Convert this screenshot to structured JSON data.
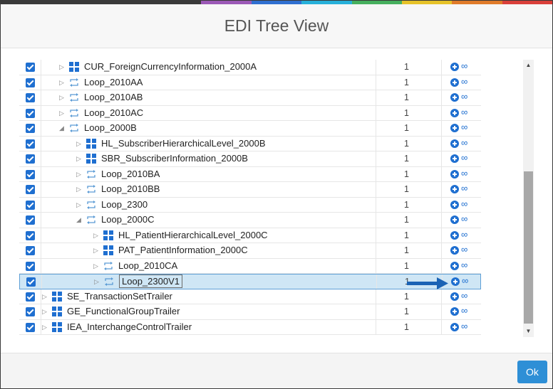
{
  "rainbow": [
    "#3a3a3a",
    "#3a3a3a",
    "#3a3a3a",
    "#3a3a3a",
    "#9b59b6",
    "#2f6fd0",
    "#27b0d9",
    "#46b05e",
    "#e6c229",
    "#e07b2a",
    "#d9403a"
  ],
  "dialog": {
    "title": "EDI Tree View",
    "ok_label": "Ok"
  },
  "colors": {
    "accent": "#1f6fd0",
    "selected_row": "#cfe6f5",
    "arrow": "#1b63b5"
  },
  "rows": [
    {
      "label": "CUR_ForeignCurrencyInformation_2000A",
      "count": "1",
      "depth": 2,
      "icon": "segment-icon",
      "expanded": false
    },
    {
      "label": "Loop_2010AA",
      "count": "1",
      "depth": 2,
      "icon": "loop-icon",
      "expanded": false
    },
    {
      "label": "Loop_2010AB",
      "count": "1",
      "depth": 2,
      "icon": "loop-icon",
      "expanded": false
    },
    {
      "label": "Loop_2010AC",
      "count": "1",
      "depth": 2,
      "icon": "loop-icon",
      "expanded": false
    },
    {
      "label": "Loop_2000B",
      "count": "1",
      "depth": 2,
      "icon": "loop-icon",
      "expanded": true
    },
    {
      "label": "HL_SubscriberHierarchicalLevel_2000B",
      "count": "1",
      "depth": 3,
      "icon": "segment-icon",
      "expanded": false
    },
    {
      "label": "SBR_SubscriberInformation_2000B",
      "count": "1",
      "depth": 3,
      "icon": "segment-icon",
      "expanded": false
    },
    {
      "label": "Loop_2010BA",
      "count": "1",
      "depth": 3,
      "icon": "loop-icon",
      "expanded": false
    },
    {
      "label": "Loop_2010BB",
      "count": "1",
      "depth": 3,
      "icon": "loop-icon",
      "expanded": false
    },
    {
      "label": "Loop_2300",
      "count": "1",
      "depth": 3,
      "icon": "loop-icon",
      "expanded": false
    },
    {
      "label": "Loop_2000C",
      "count": "1",
      "depth": 3,
      "icon": "loop-icon",
      "expanded": true
    },
    {
      "label": "HL_PatientHierarchicalLevel_2000C",
      "count": "1",
      "depth": 4,
      "icon": "segment-icon",
      "expanded": false
    },
    {
      "label": "PAT_PatientInformation_2000C",
      "count": "1",
      "depth": 4,
      "icon": "segment-icon",
      "expanded": false
    },
    {
      "label": "Loop_2010CA",
      "count": "1",
      "depth": 4,
      "icon": "loop-icon",
      "expanded": false
    },
    {
      "label": "Loop_2300V1",
      "count": "1",
      "depth": 4,
      "icon": "loop-icon",
      "expanded": false,
      "selected": true,
      "editing": true
    },
    {
      "label": "SE_TransactionSetTrailer",
      "count": "1",
      "depth": 1,
      "icon": "segment-icon",
      "expanded": false
    },
    {
      "label": "GE_FunctionalGroupTrailer",
      "count": "1",
      "depth": 1,
      "icon": "segment-icon",
      "expanded": false
    },
    {
      "label": "IEA_InterchangeControlTrailer",
      "count": "1",
      "depth": 1,
      "icon": "segment-icon",
      "expanded": false
    }
  ],
  "actions": {
    "add_icon": "plus-circle-icon",
    "link_icon": "link-icon",
    "link_glyph": "∞"
  },
  "scrollbar": {
    "up_glyph": "▲",
    "down_glyph": "▼"
  }
}
